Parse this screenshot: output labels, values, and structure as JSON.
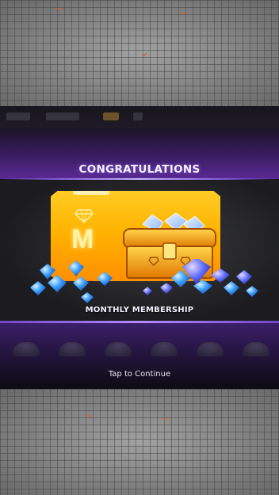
{
  "reward": {
    "title": "CONGRATULATIONS",
    "item_name": "MONTHLY MEMBERSHIP",
    "card_letter": "M"
  },
  "prompt": {
    "tap_text": "Tap to Continue"
  },
  "colors": {
    "card_gold": "#ffb300",
    "accent_purple": "#5a2a94",
    "diamond_blue": "#2f8cff"
  },
  "icons": [
    "diamond-icon",
    "treasure-chest-icon",
    "diamond-pile-icon"
  ]
}
